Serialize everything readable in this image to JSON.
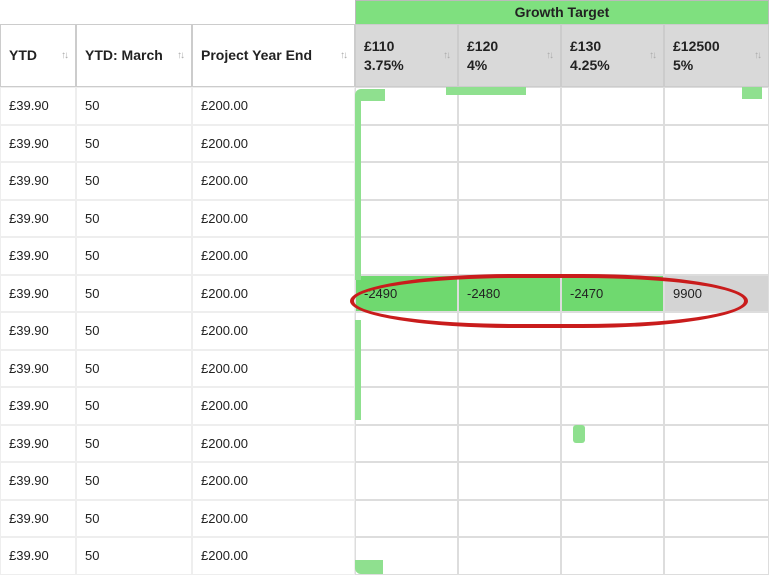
{
  "growth_header": "Growth Target",
  "columns": {
    "ytd": "YTD",
    "ytd_march": "YTD: March",
    "project_year_end": "Project Year End",
    "growth": [
      {
        "price": "£110",
        "pct": "3.75%"
      },
      {
        "price": "£120",
        "pct": "4%"
      },
      {
        "price": "£130",
        "pct": "4.25%"
      },
      {
        "price": "£12500",
        "pct": "5%"
      }
    ]
  },
  "rows": [
    {
      "ytd": "£39.90",
      "mar": "50",
      "pye": "£200.00",
      "g": [
        "",
        "",
        "",
        ""
      ],
      "hl": false
    },
    {
      "ytd": "£39.90",
      "mar": "50",
      "pye": "£200.00",
      "g": [
        "",
        "",
        "",
        ""
      ],
      "hl": false
    },
    {
      "ytd": "£39.90",
      "mar": "50",
      "pye": "£200.00",
      "g": [
        "",
        "",
        "",
        ""
      ],
      "hl": false
    },
    {
      "ytd": "£39.90",
      "mar": "50",
      "pye": "£200.00",
      "g": [
        "",
        "",
        "",
        ""
      ],
      "hl": false
    },
    {
      "ytd": "£39.90",
      "mar": "50",
      "pye": "£200.00",
      "g": [
        "",
        "",
        "",
        ""
      ],
      "hl": false
    },
    {
      "ytd": "£39.90",
      "mar": "50",
      "pye": "£200.00",
      "g": [
        "-2490",
        "-2480",
        "-2470",
        "9900"
      ],
      "hl": true
    },
    {
      "ytd": "£39.90",
      "mar": "50",
      "pye": "£200.00",
      "g": [
        "",
        "",
        "",
        ""
      ],
      "hl": false
    },
    {
      "ytd": "£39.90",
      "mar": "50",
      "pye": "£200.00",
      "g": [
        "",
        "",
        "",
        ""
      ],
      "hl": false
    },
    {
      "ytd": "£39.90",
      "mar": "50",
      "pye": "£200.00",
      "g": [
        "",
        "",
        "",
        ""
      ],
      "hl": false
    },
    {
      "ytd": "£39.90",
      "mar": "50",
      "pye": "£200.00",
      "g": [
        "",
        "",
        "",
        ""
      ],
      "hl": false
    },
    {
      "ytd": "£39.90",
      "mar": "50",
      "pye": "£200.00",
      "g": [
        "",
        "",
        "",
        ""
      ],
      "hl": false
    },
    {
      "ytd": "£39.90",
      "mar": "50",
      "pye": "£200.00",
      "g": [
        "",
        "",
        "",
        ""
      ],
      "hl": false
    },
    {
      "ytd": "£39.90",
      "mar": "50",
      "pye": "£200.00",
      "g": [
        "",
        "",
        "",
        ""
      ],
      "hl": false
    }
  ]
}
